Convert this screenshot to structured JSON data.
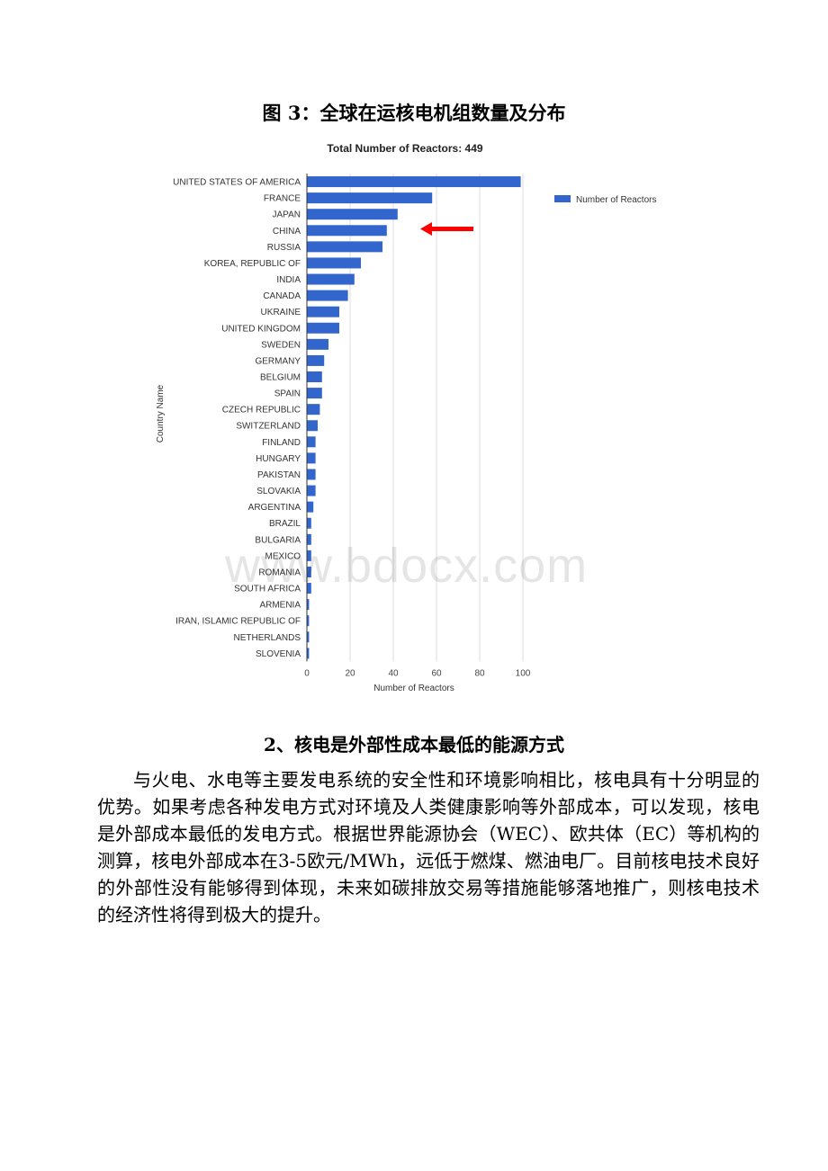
{
  "figure": {
    "caption": "图 3：全球在运核电机组数量及分布"
  },
  "watermark": "www.bdocx.com",
  "chart_data": {
    "type": "bar",
    "orientation": "horizontal",
    "title": "Total Number of Reactors: 449",
    "xlabel": "Number of Reactors",
    "ylabel": "Country Name",
    "xlim": [
      0,
      100
    ],
    "xticks": [
      0,
      20,
      40,
      60,
      80,
      100
    ],
    "grid": true,
    "legend": {
      "position": "top-right",
      "entries": [
        "Number of Reactors"
      ]
    },
    "bar_color": "#3366cc",
    "annotation": {
      "type": "arrow",
      "color": "#ff0000",
      "points_to": "CHINA"
    },
    "categories": [
      "UNITED STATES OF AMERICA",
      "FRANCE",
      "JAPAN",
      "CHINA",
      "RUSSIA",
      "KOREA, REPUBLIC OF",
      "INDIA",
      "CANADA",
      "UKRAINE",
      "UNITED KINGDOM",
      "SWEDEN",
      "GERMANY",
      "BELGIUM",
      "SPAIN",
      "CZECH REPUBLIC",
      "SWITZERLAND",
      "FINLAND",
      "HUNGARY",
      "PAKISTAN",
      "SLOVAKIA",
      "ARGENTINA",
      "BRAZIL",
      "BULGARIA",
      "MEXICO",
      "ROMANIA",
      "SOUTH AFRICA",
      "ARMENIA",
      "IRAN, ISLAMIC REPUBLIC OF",
      "NETHERLANDS",
      "SLOVENIA"
    ],
    "series": [
      {
        "name": "Number of Reactors",
        "values": [
          99,
          58,
          42,
          37,
          35,
          25,
          22,
          19,
          15,
          15,
          10,
          8,
          7,
          7,
          6,
          5,
          4,
          4,
          4,
          4,
          3,
          2,
          2,
          2,
          2,
          2,
          1,
          1,
          1,
          1
        ]
      }
    ]
  },
  "section": {
    "heading": "2、核电是外部性成本最低的能源方式",
    "paragraph": "与火电、水电等主要发电系统的安全性和环境影响相比，核电具有十分明显的优势。如果考虑各种发电方式对环境及人类健康影响等外部成本，可以发现，核电是外部成本最低的发电方式。根据世界能源协会（WEC）、欧共体（EC）等机构的测算，核电外部成本在3-5欧元/MWh，远低于燃煤、燃油电厂。目前核电技术良好的外部性没有能够得到体现，未来如碳排放交易等措施能够落地推广，则核电技术的经济性将得到极大的提升。"
  }
}
